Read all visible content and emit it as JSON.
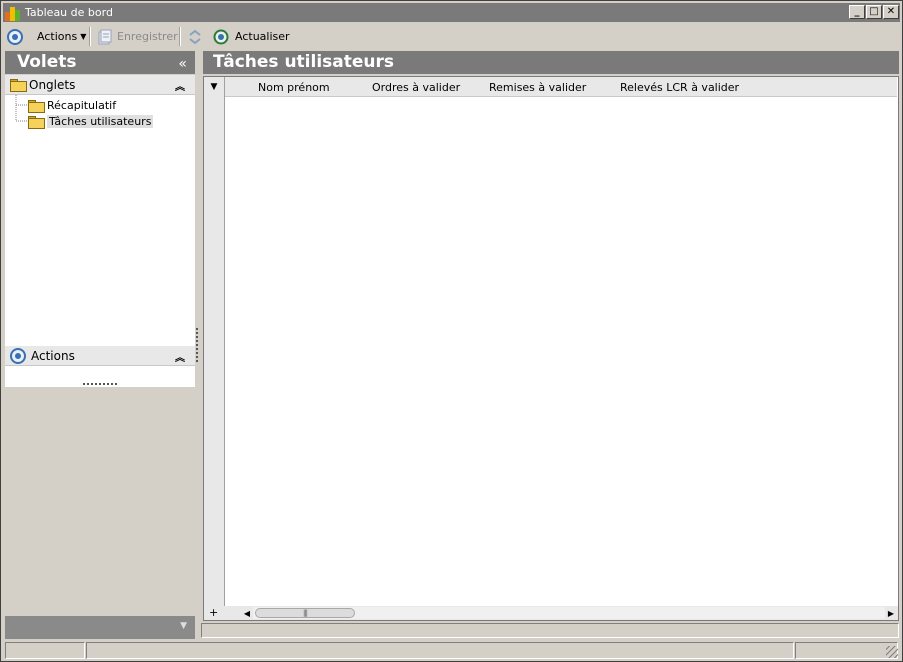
{
  "window": {
    "title": "Tableau de bord",
    "controls": {
      "minimize": "_",
      "maximize": "□",
      "close": "✕"
    }
  },
  "toolbar": {
    "actions_label": "Actions",
    "save_label": "Enregistrer",
    "refresh_label": "Actualiser"
  },
  "left_pane": {
    "title": "Volets",
    "collapse_glyph": "«",
    "tabs_group": {
      "label": "Onglets",
      "items": [
        {
          "label": "Récapitulatif",
          "selected": false
        },
        {
          "label": "Tâches utilisateurs",
          "selected": true
        }
      ]
    },
    "actions_group": {
      "label": "Actions"
    }
  },
  "main": {
    "title": "Tâches utilisateurs",
    "columns": [
      "Nom prénom",
      "Ordres à valider",
      "Remises à valider",
      "Relevés LCR à valider"
    ],
    "rows": [],
    "add_row_glyph": "+"
  },
  "colors": {
    "header_gray": "#7a7a7a",
    "window_bg": "#d4d0c8",
    "accent_blue": "#3a6fb0"
  }
}
